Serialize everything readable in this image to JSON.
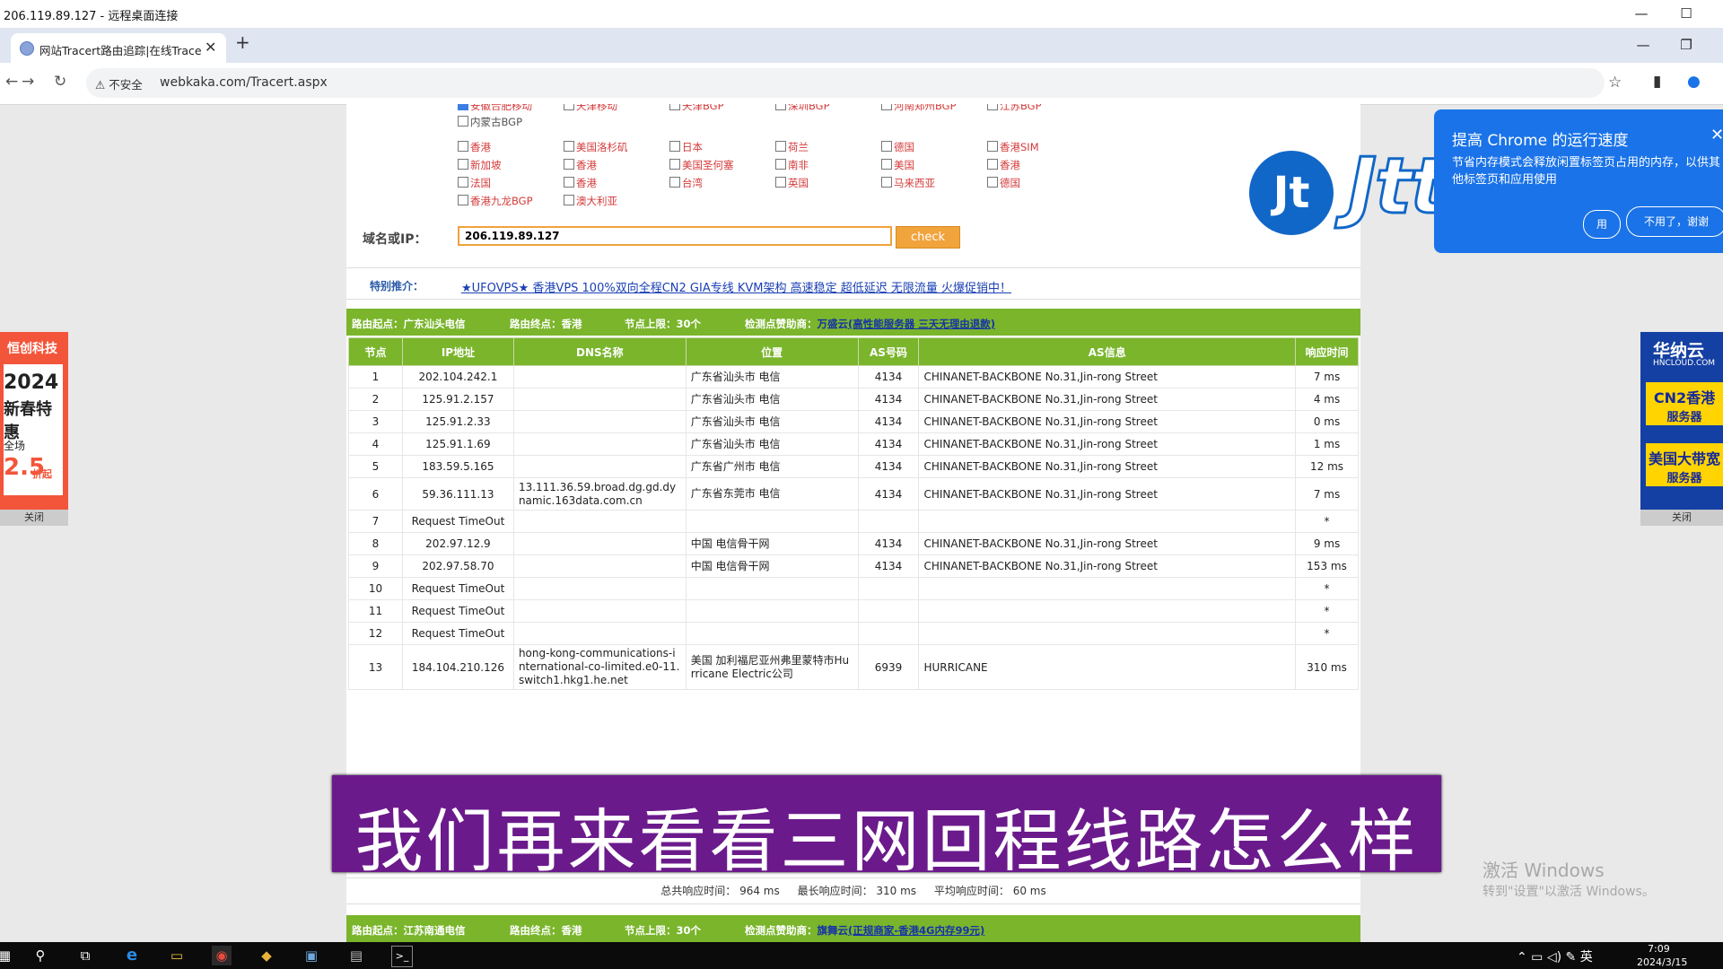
{
  "rdp": {
    "title": "206.119.89.127 - 远程桌面连接",
    "min": "—",
    "max": "☐"
  },
  "browser": {
    "tab_title": "网站Tracert路由追踪|在线Tracert",
    "tab_close": "✕",
    "new_tab": "+",
    "not_secure": "不安全",
    "url": "webkaka.com/Tracert.aspx",
    "min": "—",
    "restore": "❐",
    "back": "←",
    "forward": "→",
    "reload": "↻",
    "star": "☆",
    "sidepanel": "▮",
    "profile": "●"
  },
  "checkboxes": {
    "partial_row": [
      "安徽合肥移动",
      "天津移动",
      "天津BGP",
      "深圳BGP",
      "河南郑州BGP",
      "江苏BGP"
    ],
    "row0": [
      "内蒙古BGP"
    ],
    "row1": [
      "香港",
      "美国洛杉矶",
      "日本",
      "荷兰",
      "德国",
      "香港SIM"
    ],
    "row2": [
      "新加坡",
      "香港",
      "美国圣何塞",
      "南非",
      "美国",
      "香港"
    ],
    "row3": [
      "法国",
      "香港",
      "台湾",
      "英国",
      "马来西亚",
      "德国"
    ],
    "row4": [
      "香港九龙BGP",
      "澳大利亚"
    ]
  },
  "form": {
    "label": "域名或IP：",
    "value": "206.119.89.127",
    "check_label": "check"
  },
  "promo": {
    "label": "特别推介：",
    "text": "★UFOVPS★ 香港VPS 100%双向全程CN2 GIA专线 KVM架构 高速稳定 超低延迟 无限流量 火爆促销中！"
  },
  "route1": {
    "origin": "路由起点：广东汕头电信",
    "dest": "路由终点：香港",
    "limit": "节点上限：30个",
    "sponsor_label": "检测点赞助商：",
    "sponsor": "万盛云",
    "sponsor_link": "(高性能服务器 三天无理由退款)"
  },
  "table": {
    "headers": [
      "节点",
      "IP地址",
      "DNS名称",
      "位置",
      "AS号码",
      "AS信息",
      "响应时间"
    ],
    "rows": [
      [
        "1",
        "202.104.242.1",
        "",
        "广东省汕头市 电信",
        "4134",
        "CHINANET-BACKBONE No.31,Jin-rong Street",
        "7 ms"
      ],
      [
        "2",
        "125.91.2.157",
        "",
        "广东省汕头市 电信",
        "4134",
        "CHINANET-BACKBONE No.31,Jin-rong Street",
        "4 ms"
      ],
      [
        "3",
        "125.91.2.33",
        "",
        "广东省汕头市 电信",
        "4134",
        "CHINANET-BACKBONE No.31,Jin-rong Street",
        "0 ms"
      ],
      [
        "4",
        "125.91.1.69",
        "",
        "广东省汕头市 电信",
        "4134",
        "CHINANET-BACKBONE No.31,Jin-rong Street",
        "1 ms"
      ],
      [
        "5",
        "183.59.5.165",
        "",
        "广东省广州市 电信",
        "4134",
        "CHINANET-BACKBONE No.31,Jin-rong Street",
        "12 ms"
      ],
      [
        "6",
        "59.36.111.13",
        "13.111.36.59.broad.dg.gd.dynamic.163data.com.cn",
        "广东省东莞市 电信",
        "4134",
        "CHINANET-BACKBONE No.31,Jin-rong Street",
        "7 ms"
      ],
      [
        "7",
        "Request TimeOut",
        "",
        "",
        "",
        "",
        "*"
      ],
      [
        "8",
        "202.97.12.9",
        "",
        "中国 电信骨干网",
        "4134",
        "CHINANET-BACKBONE No.31,Jin-rong Street",
        "9 ms"
      ],
      [
        "9",
        "202.97.58.70",
        "",
        "中国 电信骨干网",
        "4134",
        "CHINANET-BACKBONE No.31,Jin-rong Street",
        "153 ms"
      ],
      [
        "10",
        "Request TimeOut",
        "",
        "",
        "",
        "",
        "*"
      ],
      [
        "11",
        "Request TimeOut",
        "",
        "",
        "",
        "",
        "*"
      ],
      [
        "12",
        "Request TimeOut",
        "",
        "",
        "",
        "",
        "*"
      ],
      [
        "13",
        "184.104.210.126",
        "hong-kong-communications-international-co-limited.e0-11.switch1.hkg1.he.net",
        "美国 加利福尼亚州弗里蒙特市Hurricane Electric公司",
        "6939",
        "HURRICANE",
        "310 ms"
      ]
    ]
  },
  "summary": {
    "total": "总共响应时间：  964 ms",
    "max": "最长响应时间：  310 ms",
    "avg": "平均响应时间：   60 ms"
  },
  "route2": {
    "origin": "路由起点：江苏南通电信",
    "dest": "路由终点：香港",
    "limit": "节点上限：30个",
    "sponsor_label": "检测点赞助商：",
    "sponsor": "旗舞云",
    "sponsor_link": "(正规商家-香港4G内存99元)"
  },
  "subtitle": "我们再来看看三网回程线路怎么样",
  "logo": {
    "mark": "Jt",
    "word": "Jtti.cc"
  },
  "chrome_popup": {
    "title": "提高 Chrome 的运行速度",
    "close": "✕",
    "body": "节省内存模式会释放闲置标签页占用的内存，以供其他标签页和应用使用",
    "btn_use": "用",
    "btn_no": "不用了，谢谢"
  },
  "ad_left": {
    "brand": "恒创科技",
    "year": "2024",
    "promo": "新春特惠",
    "scope": "全场",
    "discount": "2.5",
    "unit": "折起",
    "close": "关闭"
  },
  "ad_right": {
    "brand": "华纳云",
    "sub": "HNCLOUD.COM",
    "item1a": "CN2香港",
    "item1b": "服务器",
    "item2a": "美国大带宽",
    "item2b": "服务器",
    "close": "关闭"
  },
  "watermark": {
    "title": "激活 Windows",
    "sub": "转到\"设置\"以激活 Windows。"
  },
  "taskbar": {
    "start": "▦",
    "search": "⚲",
    "taskview": "⧉",
    "ie": "e",
    "explorer": "▭",
    "chrome": "◉",
    "app5": "◆",
    "app6": "▣",
    "app7": "▤",
    "terminal": ">_",
    "tray": "⌃  ▭  ◁)  ✎  英",
    "time": "7:09",
    "date": "2024/3/15"
  },
  "colors": {
    "green": "#7ab52c",
    "orange": "#f1a33c",
    "purple": "#6b1a8c",
    "chrome_blue": "#1a73e8"
  }
}
